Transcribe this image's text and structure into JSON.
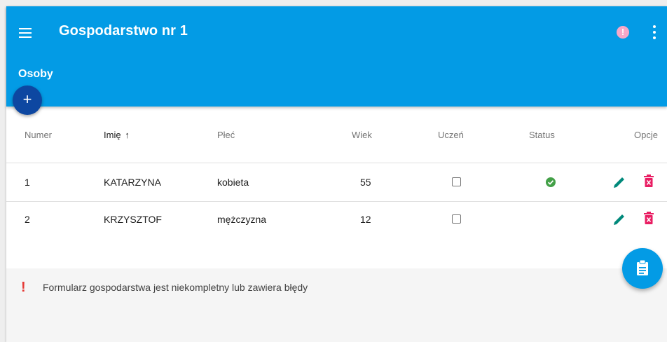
{
  "header": {
    "title": "Gospodarstwo nr 1",
    "subtitle": "Osoby",
    "alert_symbol": "!",
    "add_label": "+",
    "icons": [
      "menu-icon",
      "alert-icon",
      "more-vert-icon"
    ]
  },
  "table": {
    "columns": [
      "Numer",
      "Imię",
      "Płeć",
      "Wiek",
      "Uczeń",
      "Status",
      "Opcje"
    ],
    "sort_indicator": "↑",
    "rows": [
      {
        "number": "1",
        "name": "KATARZYNA",
        "gender": "kobieta",
        "age": "55",
        "student": false,
        "status": "ok"
      },
      {
        "number": "2",
        "name": "KRZYSZTOF",
        "gender": "mężczyzna",
        "age": "12",
        "student": false,
        "status": ""
      }
    ]
  },
  "footer": {
    "error_symbol": "!",
    "error_message": "Formularz gospodarstwa jest niekompletny lub zawiera błędy"
  },
  "colors": {
    "header": "#039be5",
    "add_button": "#0d47a1",
    "edit_icon": "#00897b",
    "delete_icon": "#e91e63",
    "status_ok": "#43a047",
    "error": "#e53935",
    "alert_icon": "#f7a8c8"
  }
}
